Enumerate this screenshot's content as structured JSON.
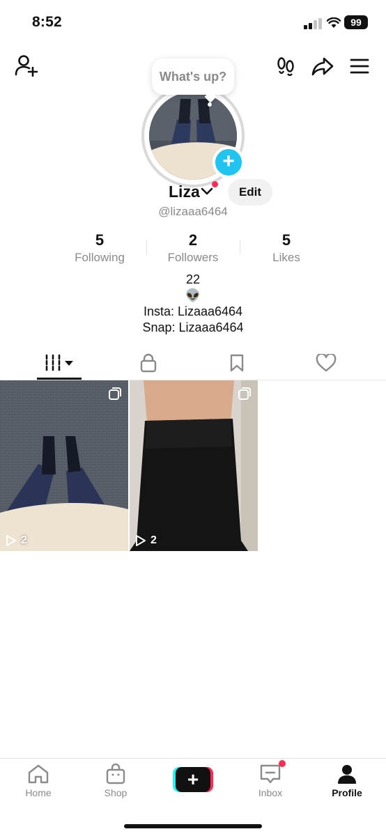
{
  "status_bar": {
    "time": "8:52",
    "battery": "99"
  },
  "header": {
    "bubble_text": "What's up?"
  },
  "profile": {
    "display_name": "Liza",
    "edit_label": "Edit",
    "handle": "@lizaaa6464"
  },
  "stats": [
    {
      "value": "5",
      "label": "Following"
    },
    {
      "value": "2",
      "label": "Followers"
    },
    {
      "value": "5",
      "label": "Likes"
    }
  ],
  "bio": {
    "line1": "22",
    "line2": "👽",
    "line3": "Insta: Lizaaa6464",
    "line4": "Snap: Lizaaa6464"
  },
  "videos": [
    {
      "views": "2"
    },
    {
      "views": "2"
    }
  ],
  "nav": {
    "home": "Home",
    "shop": "Shop",
    "inbox": "Inbox",
    "profile": "Profile"
  },
  "colors": {
    "accent": "#fe2c55",
    "cyan": "#25f4ee",
    "badge_blue": "#20c4ef"
  },
  "icons": {
    "header_left": "add-user-icon",
    "header_right": [
      "footprints-icon",
      "share-icon",
      "menu-icon"
    ],
    "tabs": [
      "grid-icon",
      "lock-icon",
      "bookmark-icon",
      "heart-icon"
    ]
  }
}
